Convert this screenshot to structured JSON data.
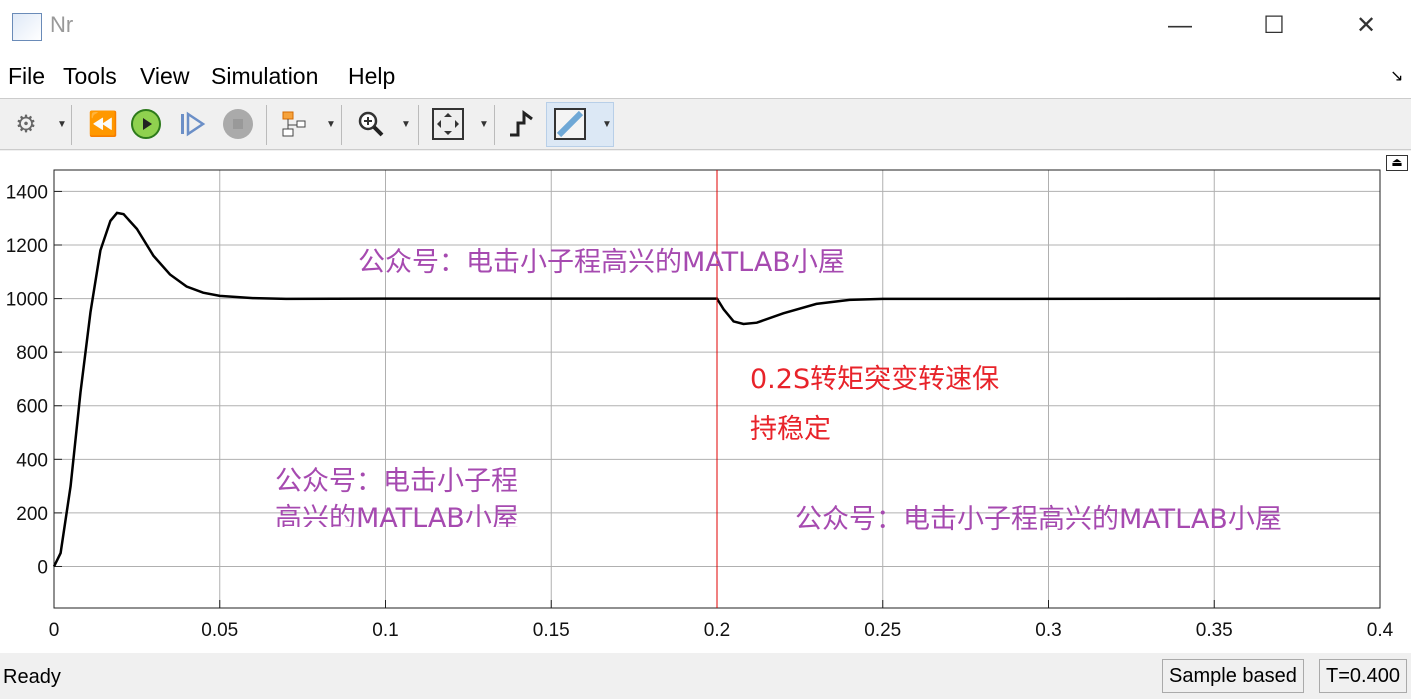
{
  "window": {
    "title": "Nr",
    "minimize": "—",
    "maximize": "☐",
    "close": "✕"
  },
  "menu": [
    "File",
    "Tools",
    "View",
    "Simulation",
    "Help"
  ],
  "toolbar": {
    "icons": [
      "gear-icon",
      "step-back-icon",
      "run-icon",
      "step-forward-icon",
      "stop-icon",
      "highlight-icon",
      "zoom-icon",
      "fit-icon",
      "signal-icon",
      "cursor-measure-icon"
    ]
  },
  "status": {
    "ready": "Ready",
    "mode": "Sample based",
    "time": "T=0.400"
  },
  "annotations": {
    "wm1": "公众号：电击小子程高兴的MATLAB小屋",
    "wm2_line1": "公众号：电击小子程",
    "wm2_line2": "高兴的MATLAB小屋",
    "wm3": "公众号：电击小子程高兴的MATLAB小屋",
    "note_line1": "0.2S转矩突变转速保",
    "note_line2": "持稳定"
  },
  "colors": {
    "line": "#000000",
    "cursor": "#e00000",
    "grid": "#b0b0b0",
    "watermark": "#a64ab0",
    "note": "#e8232a"
  },
  "chart_data": {
    "type": "line",
    "title": "Nr",
    "xlim": [
      0,
      0.4
    ],
    "ylim": [
      -155,
      1480
    ],
    "xticks": [
      0,
      0.05,
      0.1,
      0.15,
      0.2,
      0.25,
      0.3,
      0.35,
      0.4
    ],
    "xtick_labels": [
      "0",
      "0.05",
      "0.1",
      "0.15",
      "0.2",
      "0.25",
      "0.3",
      "0.35",
      "0.4"
    ],
    "yticks": [
      0,
      200,
      400,
      600,
      800,
      1000,
      1200,
      1400
    ],
    "ytick_labels": [
      "0",
      "200",
      "400",
      "600",
      "800",
      "1000",
      "1200",
      "1400"
    ],
    "grid": true,
    "cursor_x": 0.2,
    "series": [
      {
        "name": "Nr",
        "x": [
          0,
          0.002,
          0.005,
          0.008,
          0.011,
          0.014,
          0.017,
          0.019,
          0.021,
          0.025,
          0.03,
          0.035,
          0.04,
          0.045,
          0.05,
          0.06,
          0.07,
          0.1,
          0.2,
          0.202,
          0.205,
          0.208,
          0.212,
          0.22,
          0.23,
          0.24,
          0.25,
          0.4
        ],
        "y": [
          0,
          50,
          300,
          650,
          950,
          1180,
          1290,
          1320,
          1315,
          1260,
          1160,
          1090,
          1045,
          1022,
          1010,
          1002,
          999,
          1000,
          1000,
          960,
          915,
          905,
          910,
          945,
          980,
          995,
          999,
          1000
        ]
      }
    ]
  }
}
